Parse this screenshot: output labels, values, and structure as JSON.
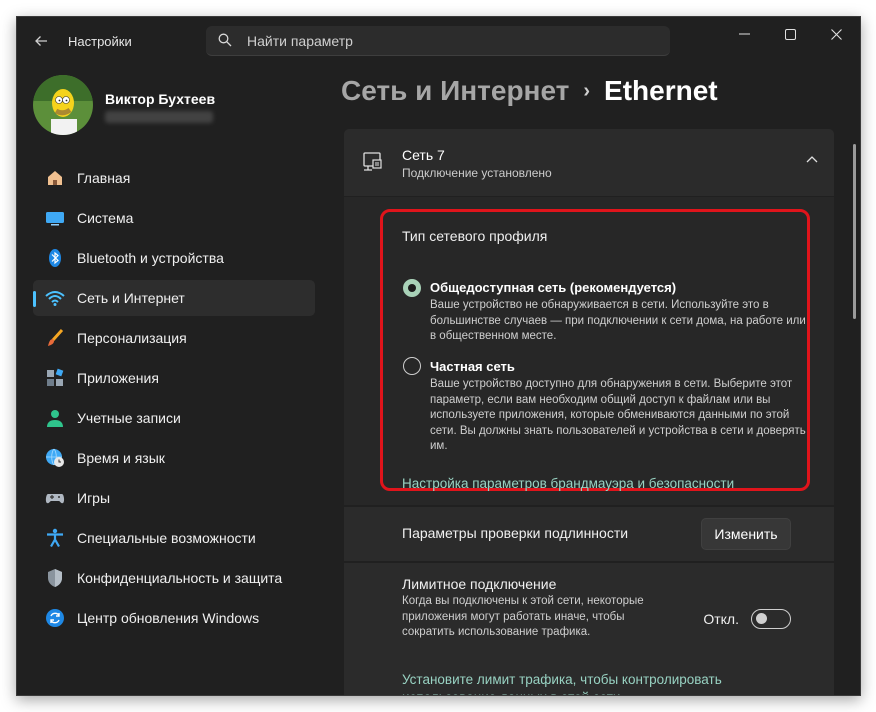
{
  "window": {
    "title": "Настройки",
    "search_placeholder": "Найти параметр",
    "controls": {
      "minimize": "minimize-icon",
      "maximize": "maximize-icon",
      "close": "close-icon"
    }
  },
  "profile": {
    "name": "Виктор Бухтеев"
  },
  "sidebar": {
    "items": [
      {
        "label": "Главная",
        "icon": "home-icon",
        "active": false
      },
      {
        "label": "Система",
        "icon": "system-icon",
        "active": false
      },
      {
        "label": "Bluetooth и устройства",
        "icon": "bluetooth-icon",
        "active": false
      },
      {
        "label": "Сеть и Интернет",
        "icon": "wifi-icon",
        "active": true
      },
      {
        "label": "Персонализация",
        "icon": "brush-icon",
        "active": false
      },
      {
        "label": "Приложения",
        "icon": "apps-icon",
        "active": false
      },
      {
        "label": "Учетные записи",
        "icon": "account-icon",
        "active": false
      },
      {
        "label": "Время и язык",
        "icon": "globe-clock-icon",
        "active": false
      },
      {
        "label": "Игры",
        "icon": "gamepad-icon",
        "active": false
      },
      {
        "label": "Специальные возможности",
        "icon": "accessibility-icon",
        "active": false
      },
      {
        "label": "Конфиденциальность и защита",
        "icon": "shield-icon",
        "active": false
      },
      {
        "label": "Центр обновления Windows",
        "icon": "update-icon",
        "active": false
      }
    ]
  },
  "header": {
    "breadcrumb_parent": "Сеть и Интернет",
    "separator": "›",
    "current": "Ethernet"
  },
  "network": {
    "name": "Сеть 7",
    "status": "Подключение установлено",
    "profile_type_title": "Тип сетевого профиля",
    "options": [
      {
        "title": "Общедоступная сеть (рекомендуется)",
        "description": "Ваше устройство не обнаруживается в сети. Используйте это в большинстве случаев — при подключении к сети дома, на работе или в общественном месте.",
        "selected": true
      },
      {
        "title": "Частная сеть",
        "description": "Ваше устройство доступно для обнаружения в сети. Выберите этот параметр, если вам необходим общий доступ к файлам или вы используете приложения, которые обмениваются данными по этой сети. Вы должны знать пользователей и устройства в сети и доверять им.",
        "selected": false
      }
    ],
    "firewall_link": "Настройка параметров брандмауэра и безопасности"
  },
  "auth": {
    "label": "Параметры проверки подлинности",
    "button": "Изменить"
  },
  "metered": {
    "title": "Лимитное подключение",
    "description": "Когда вы подключены к этой сети, некоторые приложения могут работать иначе, чтобы сократить использование трафика.",
    "toggle_state": "Откл.",
    "toggle_on": false,
    "limit_link": "Установите лимит трафика, чтобы контролировать использование данных в этой сети"
  },
  "colors": {
    "window_bg": "#202020",
    "card_bg": "#2b2b2b",
    "accent": "#4cc2ff",
    "link": "#98d2c2",
    "highlight": "#e0141b"
  }
}
